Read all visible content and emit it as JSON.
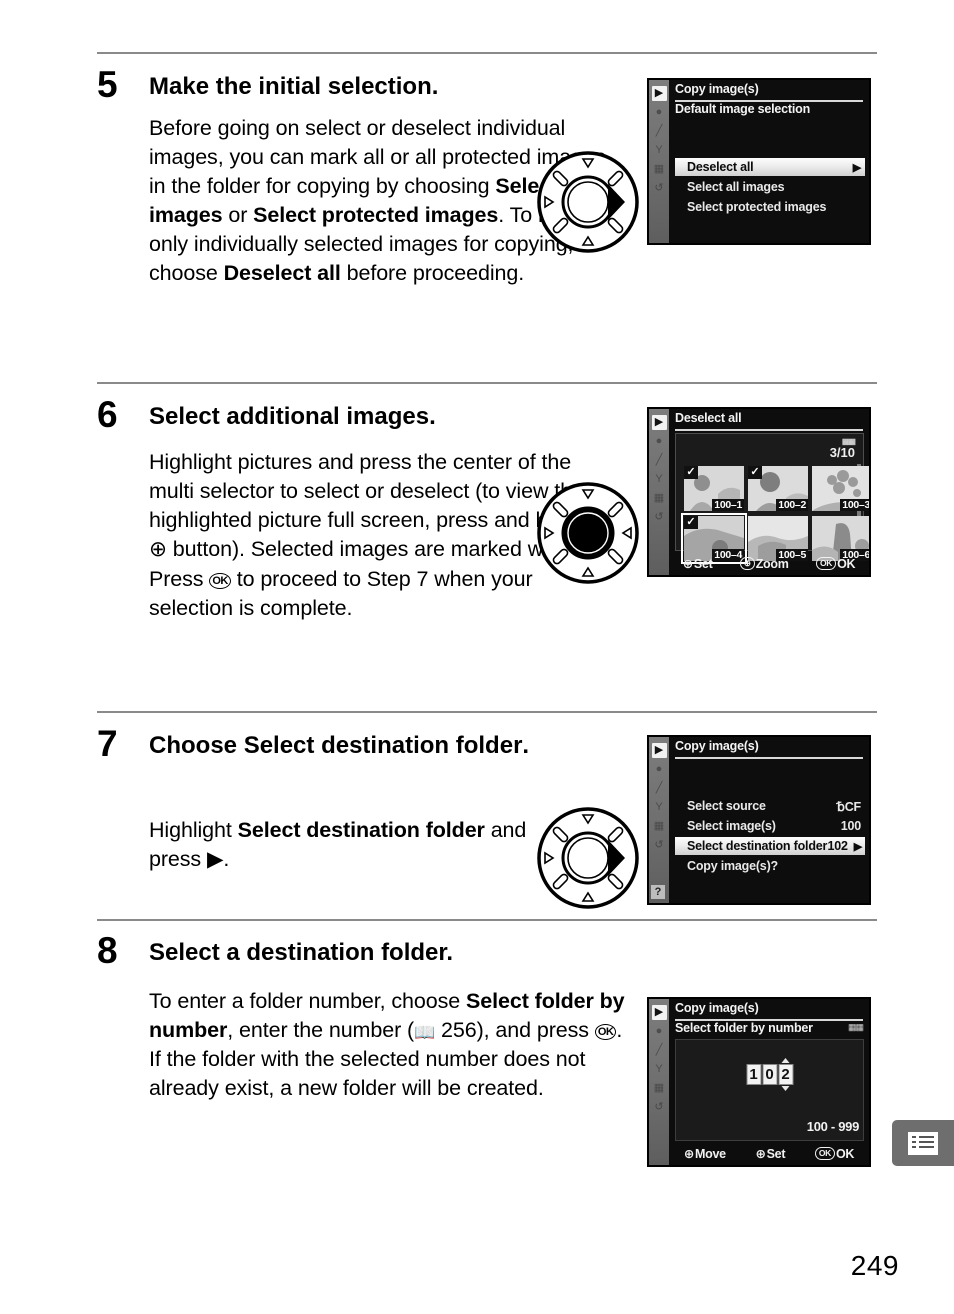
{
  "page": {
    "number": "249",
    "tab_icon": "menu-list-icon"
  },
  "steps": [
    {
      "number": "5",
      "title": "Make the initial selection.",
      "body_html": "Before going on select or deselect individual images, you can mark all or all protected images in the folder for copying by choosing <b>Select all images</b> or <b>Select protected images</b>.  To mark only individually selected images for copying, choose <b>Deselect all</b> before proceeding.",
      "dial_icon": "multi-selector-right-icon"
    },
    {
      "number": "6",
      "title": "Select additional images.",
      "body_html": "Highlight pictures and press the center of the multi selector to select or deselect (to view the highlighted picture full screen, press and hold the <span class=\"sym\">&#8853;</span> button).  Selected images are marked with a <b class=\"sym\">&#10004;</b>.  Press <span class=\"okglyph\">OK</span> to proceed to Step 7 when your selection is complete.",
      "dial_icon": "multi-selector-center-icon"
    },
    {
      "number": "7",
      "title_html": "Choose <b>Select destination folder</b>.",
      "title": "Choose Select destination folder.",
      "body_html": "Highlight <b>Select destination folder</b> and press <b class=\"sym\">&#9654;</b>.",
      "dial_icon": "multi-selector-right-icon"
    },
    {
      "number": "8",
      "title": "Select a destination folder.",
      "body_html": "To enter a folder number, choose <b>Select folder by number</b>, enter the number (<span class=\"bookglyph sym\">&#128214;</span> 256), and press <span class=\"okglyph\">OK</span>.  If the folder with the selected number does not already exist, a new folder will be created.",
      "dial_icon": null
    }
  ],
  "lcd_screens": {
    "step5": {
      "title": "Copy image(s)",
      "subtitle": "Default image selection",
      "rows": [
        {
          "label": "Deselect all",
          "value": "",
          "selected": true,
          "arrow": "▶"
        },
        {
          "label": "Select all images",
          "value": "",
          "selected": false,
          "arrow": ""
        },
        {
          "label": "Select protected images",
          "value": "",
          "selected": false,
          "arrow": ""
        }
      ]
    },
    "step6": {
      "title": "Deselect all",
      "count": "3/10",
      "count_icon": "card-slot-icon",
      "thumbnails": [
        {
          "name": "100–1",
          "checked": true,
          "highlighted": false
        },
        {
          "name": "100–2",
          "checked": true,
          "highlighted": false
        },
        {
          "name": "100–3",
          "checked": false,
          "highlighted": false
        },
        {
          "name": "100–4",
          "checked": true,
          "highlighted": true
        },
        {
          "name": "100–5",
          "checked": false,
          "highlighted": false
        },
        {
          "name": "100–6",
          "checked": false,
          "highlighted": false
        }
      ],
      "footer": [
        {
          "key": "⊕",
          "label": "Set"
        },
        {
          "key": "⊕",
          "label": "Zoom"
        },
        {
          "key": "OK",
          "label": "OK"
        }
      ]
    },
    "step7": {
      "title": "Copy image(s)",
      "rows": [
        {
          "label": "Select source",
          "value": "CF",
          "value_prefix": "␢",
          "selected": false,
          "arrow": ""
        },
        {
          "label": "Select image(s)",
          "value": "100",
          "selected": false,
          "arrow": ""
        },
        {
          "label": "Select destination folder",
          "value": "102",
          "selected": true,
          "arrow": "▶"
        },
        {
          "label": "Copy image(s)?",
          "value": "",
          "selected": false,
          "arrow": ""
        }
      ],
      "help_icon": "question-mark-icon"
    },
    "step8": {
      "title": "Copy image(s)",
      "subtitle": "Select folder by number",
      "digits": [
        "1",
        "0",
        "2"
      ],
      "active_digit_index": 2,
      "range": "100 - 999",
      "footer": [
        {
          "key": "⊕",
          "label": "Move"
        },
        {
          "key": "⊕",
          "label": "Set"
        },
        {
          "key": "OK",
          "label": "OK"
        }
      ]
    }
  },
  "sidebar_icons": [
    "playback-icon",
    "camera-icon",
    "pencil-icon",
    "wrench-icon",
    "retouch-icon",
    "recent-settings-icon"
  ]
}
